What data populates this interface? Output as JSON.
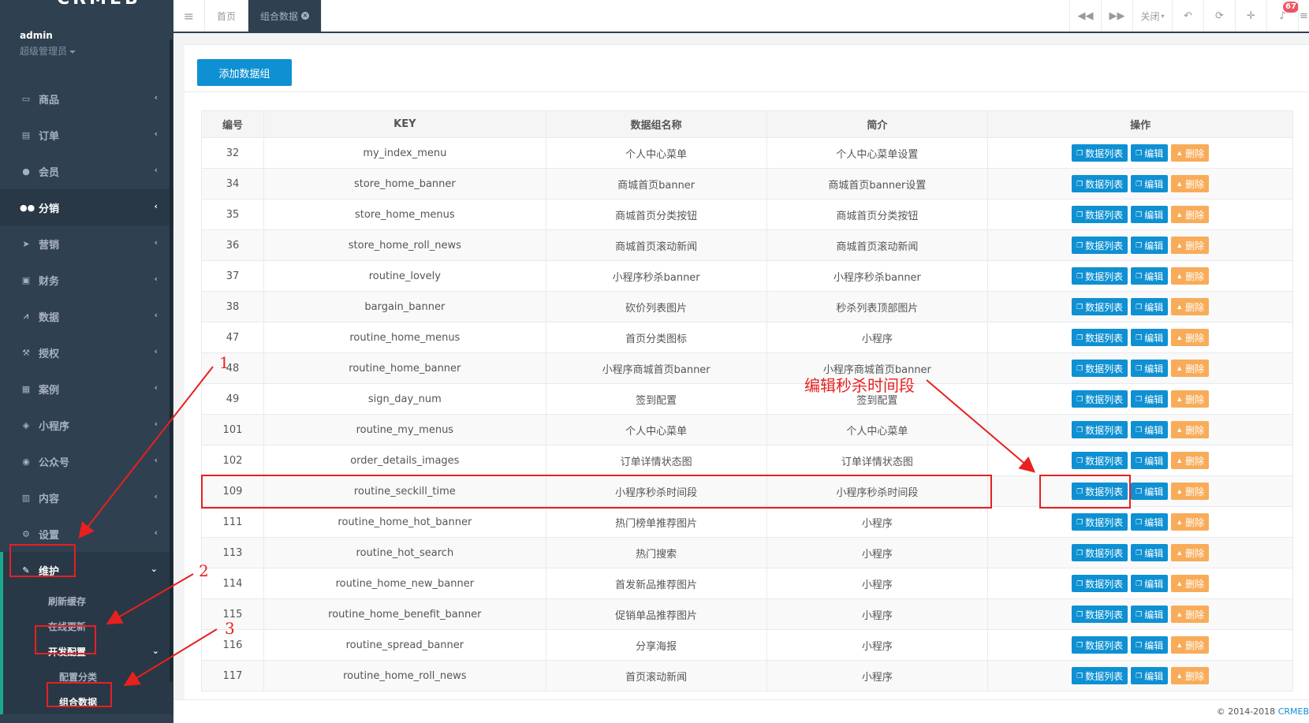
{
  "user": {
    "name": "admin",
    "role": "超级管理员"
  },
  "sidebar": {
    "items": [
      {
        "label": "商品",
        "icon": "laptop-icon"
      },
      {
        "label": "订单",
        "icon": "list-icon"
      },
      {
        "label": "会员",
        "icon": "user-icon"
      },
      {
        "label": "分销",
        "icon": "users-icon"
      },
      {
        "label": "营销",
        "icon": "send-icon"
      },
      {
        "label": "财务",
        "icon": "money-icon"
      },
      {
        "label": "数据",
        "icon": "chart-icon"
      },
      {
        "label": "授权",
        "icon": "gavel-icon"
      },
      {
        "label": "案例",
        "icon": "newspaper-icon"
      },
      {
        "label": "小程序",
        "icon": "cubes-icon"
      },
      {
        "label": "公众号",
        "icon": "wechat-icon"
      },
      {
        "label": "内容",
        "icon": "book-icon"
      },
      {
        "label": "设置",
        "icon": "gear-icon"
      }
    ],
    "maintenance": {
      "label": "维护",
      "children": [
        "刷新缓存",
        "在线更新"
      ],
      "dev": {
        "label": "开发配置",
        "children": [
          "配置分类",
          "组合数据"
        ]
      }
    }
  },
  "tabs": [
    {
      "label": "首页"
    },
    {
      "label": "组合数据"
    }
  ],
  "topbar": {
    "close_label": "关闭",
    "notif_count": "67"
  },
  "toolbar": {
    "add_label": "添加数据组"
  },
  "table": {
    "headers": [
      "编号",
      "KEY",
      "数据组名称",
      "简介",
      "操作"
    ],
    "actions": [
      "数据列表",
      "编辑",
      "删除"
    ],
    "rows": [
      {
        "id": "32",
        "key": "my_index_menu",
        "name": "个人中心菜单",
        "info": "个人中心菜单设置"
      },
      {
        "id": "34",
        "key": "store_home_banner",
        "name": "商城首页banner",
        "info": "商城首页banner设置"
      },
      {
        "id": "35",
        "key": "store_home_menus",
        "name": "商城首页分类按钮",
        "info": "商城首页分类按钮"
      },
      {
        "id": "36",
        "key": "store_home_roll_news",
        "name": "商城首页滚动新闻",
        "info": "商城首页滚动新闻"
      },
      {
        "id": "37",
        "key": "routine_lovely",
        "name": "小程序秒杀banner",
        "info": "小程序秒杀banner"
      },
      {
        "id": "38",
        "key": "bargain_banner",
        "name": "砍价列表图片",
        "info": "秒杀列表顶部图片"
      },
      {
        "id": "47",
        "key": "routine_home_menus",
        "name": "首页分类图标",
        "info": "小程序"
      },
      {
        "id": "48",
        "key": "routine_home_banner",
        "name": "小程序商城首页banner",
        "info": "小程序商城首页banner"
      },
      {
        "id": "49",
        "key": "sign_day_num",
        "name": "签到配置",
        "info": "签到配置"
      },
      {
        "id": "101",
        "key": "routine_my_menus",
        "name": "个人中心菜单",
        "info": "个人中心菜单"
      },
      {
        "id": "102",
        "key": "order_details_images",
        "name": "订单详情状态图",
        "info": "订单详情状态图"
      },
      {
        "id": "109",
        "key": "routine_seckill_time",
        "name": "小程序秒杀时间段",
        "info": "小程序秒杀时间段"
      },
      {
        "id": "111",
        "key": "routine_home_hot_banner",
        "name": "热门榜单推荐图片",
        "info": "小程序"
      },
      {
        "id": "113",
        "key": "routine_hot_search",
        "name": "热门搜索",
        "info": "小程序"
      },
      {
        "id": "114",
        "key": "routine_home_new_banner",
        "name": "首发新品推荐图片",
        "info": "小程序"
      },
      {
        "id": "115",
        "key": "routine_home_benefit_banner",
        "name": "促销单品推荐图片",
        "info": "小程序"
      },
      {
        "id": "116",
        "key": "routine_spread_banner",
        "name": "分享海报",
        "info": "小程序"
      },
      {
        "id": "117",
        "key": "routine_home_roll_news",
        "name": "首页滚动新闻",
        "info": "小程序"
      }
    ]
  },
  "footer": {
    "copyright": "© 2014-2018",
    "brand": "CRMEB"
  },
  "annotations": {
    "n1": "1",
    "n2": "2",
    "n3": "3",
    "callout": "编辑秒杀时间段"
  },
  "colors": {
    "sidebar": "#2f4050",
    "primary": "#0e90d2",
    "warning": "#f8ac59",
    "annotation": "#e82020"
  }
}
